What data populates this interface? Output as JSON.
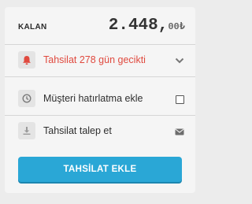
{
  "summary": {
    "label": "KALAN",
    "amount_main": "2.448,",
    "amount_decimal": "00₺"
  },
  "rows": [
    {
      "label": "Tahsilat 278 gün gecikti",
      "icon": "bell-icon",
      "trailing": "chevron-down-icon",
      "color": "#e04a3f"
    },
    {
      "label": "Müşteri hatırlatma ekle",
      "icon": "clock-icon",
      "trailing": "checkbox"
    },
    {
      "label": "Tahsilat talep et",
      "icon": "download-icon",
      "trailing": "envelope-icon"
    }
  ],
  "button": {
    "label": "TAHSİLAT EKLE",
    "color": "#2aa7d6"
  }
}
